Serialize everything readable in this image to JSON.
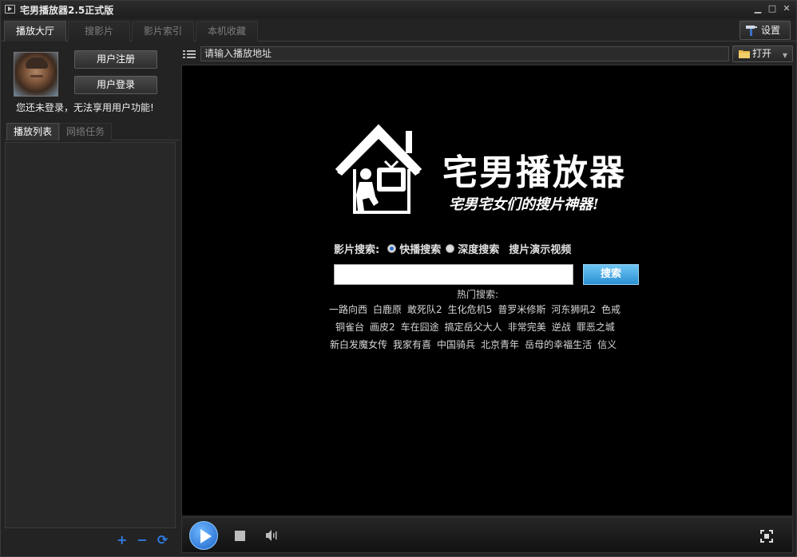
{
  "window": {
    "title": "宅男播放器2.5正式版",
    "controls": [
      "▁",
      "□",
      "✕"
    ]
  },
  "tabs": [
    {
      "label": "播放大厅",
      "active": true
    },
    {
      "label": "搜影片",
      "active": false
    },
    {
      "label": "影片索引",
      "active": false
    },
    {
      "label": "本机收藏",
      "active": false
    }
  ],
  "settings": {
    "label": "设置",
    "icon": "hammer-icon"
  },
  "user": {
    "register_label": "用户注册",
    "login_label": "用户登录",
    "warning": "您还未登录，无法享用用户功能!"
  },
  "left_tabs": [
    {
      "label": "播放列表",
      "active": true
    },
    {
      "label": "网络任务",
      "active": false
    }
  ],
  "list_tools": {
    "add": "+",
    "remove": "−",
    "refresh": "⟳"
  },
  "url_bar": {
    "value": "请输入播放地址",
    "open_label": "打开"
  },
  "logo": {
    "title": "宅男播放器",
    "slogan": "宅男宅女们的搜片神器!"
  },
  "search": {
    "label": "影片搜索:",
    "option_fast": "快播搜索",
    "option_deep": "深度搜索",
    "demo_link": "搜片演示视频",
    "button": "搜索",
    "hot_label": "热门搜索:",
    "hot_rows": [
      [
        "一路向西",
        "白鹿原",
        "敢死队2",
        "生化危机5",
        "普罗米修斯",
        "河东狮吼2",
        "色戒"
      ],
      [
        "铜雀台",
        "画皮2",
        "车在囧途",
        "搞定岳父大人",
        "非常完美",
        "逆战",
        "罪恶之城"
      ],
      [
        "新白发魔女传",
        "我家有喜",
        "中国骑兵",
        "北京青年",
        "岳母的幸福生活",
        "信义"
      ]
    ]
  },
  "colors": {
    "accent": "#2b8fd3",
    "background": "#000000",
    "panel": "#232323"
  }
}
